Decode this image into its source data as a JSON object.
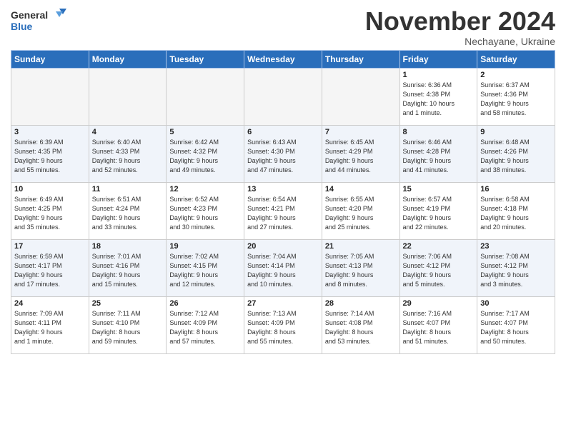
{
  "logo": {
    "line1": "General",
    "line2": "Blue"
  },
  "title": "November 2024",
  "subtitle": "Nechayane, Ukraine",
  "days_of_week": [
    "Sunday",
    "Monday",
    "Tuesday",
    "Wednesday",
    "Thursday",
    "Friday",
    "Saturday"
  ],
  "weeks": [
    [
      {
        "day": "",
        "detail": ""
      },
      {
        "day": "",
        "detail": ""
      },
      {
        "day": "",
        "detail": ""
      },
      {
        "day": "",
        "detail": ""
      },
      {
        "day": "",
        "detail": ""
      },
      {
        "day": "1",
        "detail": "Sunrise: 6:36 AM\nSunset: 4:38 PM\nDaylight: 10 hours\nand 1 minute."
      },
      {
        "day": "2",
        "detail": "Sunrise: 6:37 AM\nSunset: 4:36 PM\nDaylight: 9 hours\nand 58 minutes."
      }
    ],
    [
      {
        "day": "3",
        "detail": "Sunrise: 6:39 AM\nSunset: 4:35 PM\nDaylight: 9 hours\nand 55 minutes."
      },
      {
        "day": "4",
        "detail": "Sunrise: 6:40 AM\nSunset: 4:33 PM\nDaylight: 9 hours\nand 52 minutes."
      },
      {
        "day": "5",
        "detail": "Sunrise: 6:42 AM\nSunset: 4:32 PM\nDaylight: 9 hours\nand 49 minutes."
      },
      {
        "day": "6",
        "detail": "Sunrise: 6:43 AM\nSunset: 4:30 PM\nDaylight: 9 hours\nand 47 minutes."
      },
      {
        "day": "7",
        "detail": "Sunrise: 6:45 AM\nSunset: 4:29 PM\nDaylight: 9 hours\nand 44 minutes."
      },
      {
        "day": "8",
        "detail": "Sunrise: 6:46 AM\nSunset: 4:28 PM\nDaylight: 9 hours\nand 41 minutes."
      },
      {
        "day": "9",
        "detail": "Sunrise: 6:48 AM\nSunset: 4:26 PM\nDaylight: 9 hours\nand 38 minutes."
      }
    ],
    [
      {
        "day": "10",
        "detail": "Sunrise: 6:49 AM\nSunset: 4:25 PM\nDaylight: 9 hours\nand 35 minutes."
      },
      {
        "day": "11",
        "detail": "Sunrise: 6:51 AM\nSunset: 4:24 PM\nDaylight: 9 hours\nand 33 minutes."
      },
      {
        "day": "12",
        "detail": "Sunrise: 6:52 AM\nSunset: 4:23 PM\nDaylight: 9 hours\nand 30 minutes."
      },
      {
        "day": "13",
        "detail": "Sunrise: 6:54 AM\nSunset: 4:21 PM\nDaylight: 9 hours\nand 27 minutes."
      },
      {
        "day": "14",
        "detail": "Sunrise: 6:55 AM\nSunset: 4:20 PM\nDaylight: 9 hours\nand 25 minutes."
      },
      {
        "day": "15",
        "detail": "Sunrise: 6:57 AM\nSunset: 4:19 PM\nDaylight: 9 hours\nand 22 minutes."
      },
      {
        "day": "16",
        "detail": "Sunrise: 6:58 AM\nSunset: 4:18 PM\nDaylight: 9 hours\nand 20 minutes."
      }
    ],
    [
      {
        "day": "17",
        "detail": "Sunrise: 6:59 AM\nSunset: 4:17 PM\nDaylight: 9 hours\nand 17 minutes."
      },
      {
        "day": "18",
        "detail": "Sunrise: 7:01 AM\nSunset: 4:16 PM\nDaylight: 9 hours\nand 15 minutes."
      },
      {
        "day": "19",
        "detail": "Sunrise: 7:02 AM\nSunset: 4:15 PM\nDaylight: 9 hours\nand 12 minutes."
      },
      {
        "day": "20",
        "detail": "Sunrise: 7:04 AM\nSunset: 4:14 PM\nDaylight: 9 hours\nand 10 minutes."
      },
      {
        "day": "21",
        "detail": "Sunrise: 7:05 AM\nSunset: 4:13 PM\nDaylight: 9 hours\nand 8 minutes."
      },
      {
        "day": "22",
        "detail": "Sunrise: 7:06 AM\nSunset: 4:12 PM\nDaylight: 9 hours\nand 5 minutes."
      },
      {
        "day": "23",
        "detail": "Sunrise: 7:08 AM\nSunset: 4:12 PM\nDaylight: 9 hours\nand 3 minutes."
      }
    ],
    [
      {
        "day": "24",
        "detail": "Sunrise: 7:09 AM\nSunset: 4:11 PM\nDaylight: 9 hours\nand 1 minute."
      },
      {
        "day": "25",
        "detail": "Sunrise: 7:11 AM\nSunset: 4:10 PM\nDaylight: 8 hours\nand 59 minutes."
      },
      {
        "day": "26",
        "detail": "Sunrise: 7:12 AM\nSunset: 4:09 PM\nDaylight: 8 hours\nand 57 minutes."
      },
      {
        "day": "27",
        "detail": "Sunrise: 7:13 AM\nSunset: 4:09 PM\nDaylight: 8 hours\nand 55 minutes."
      },
      {
        "day": "28",
        "detail": "Sunrise: 7:14 AM\nSunset: 4:08 PM\nDaylight: 8 hours\nand 53 minutes."
      },
      {
        "day": "29",
        "detail": "Sunrise: 7:16 AM\nSunset: 4:07 PM\nDaylight: 8 hours\nand 51 minutes."
      },
      {
        "day": "30",
        "detail": "Sunrise: 7:17 AM\nSunset: 4:07 PM\nDaylight: 8 hours\nand 50 minutes."
      }
    ]
  ]
}
